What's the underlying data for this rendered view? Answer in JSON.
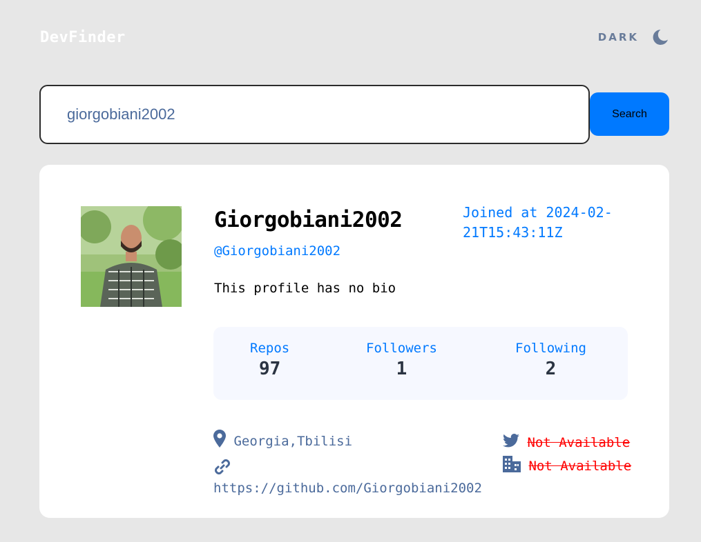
{
  "app": {
    "logo": "DevFinder",
    "theme_label": "DARK"
  },
  "search": {
    "value": "giorgobiani2002",
    "button_label": "Search"
  },
  "profile": {
    "name": "Giorgobiani2002",
    "login": "@Giorgobiani2002",
    "joined": "Joined at 2024-02-21T15:43:11Z",
    "bio": "This profile has no bio",
    "stats": [
      {
        "label": "Repos",
        "value": "97"
      },
      {
        "label": "Followers",
        "value": "1"
      },
      {
        "label": "Following",
        "value": "2"
      }
    ],
    "location": "Georgia,Tbilisi",
    "blog": "https://github.com/Giorgobiani2002",
    "twitter": "Not Available",
    "company": "Not Available"
  },
  "icons": {
    "theme": "moon-icon",
    "location": "location-pin-icon",
    "blog": "link-icon",
    "twitter": "twitter-icon",
    "company": "building-icon"
  },
  "colors": {
    "accent": "#0079ff",
    "muted": "#4b6a9b",
    "unavailable": "#ff0000",
    "background": "#e7e7e7"
  }
}
